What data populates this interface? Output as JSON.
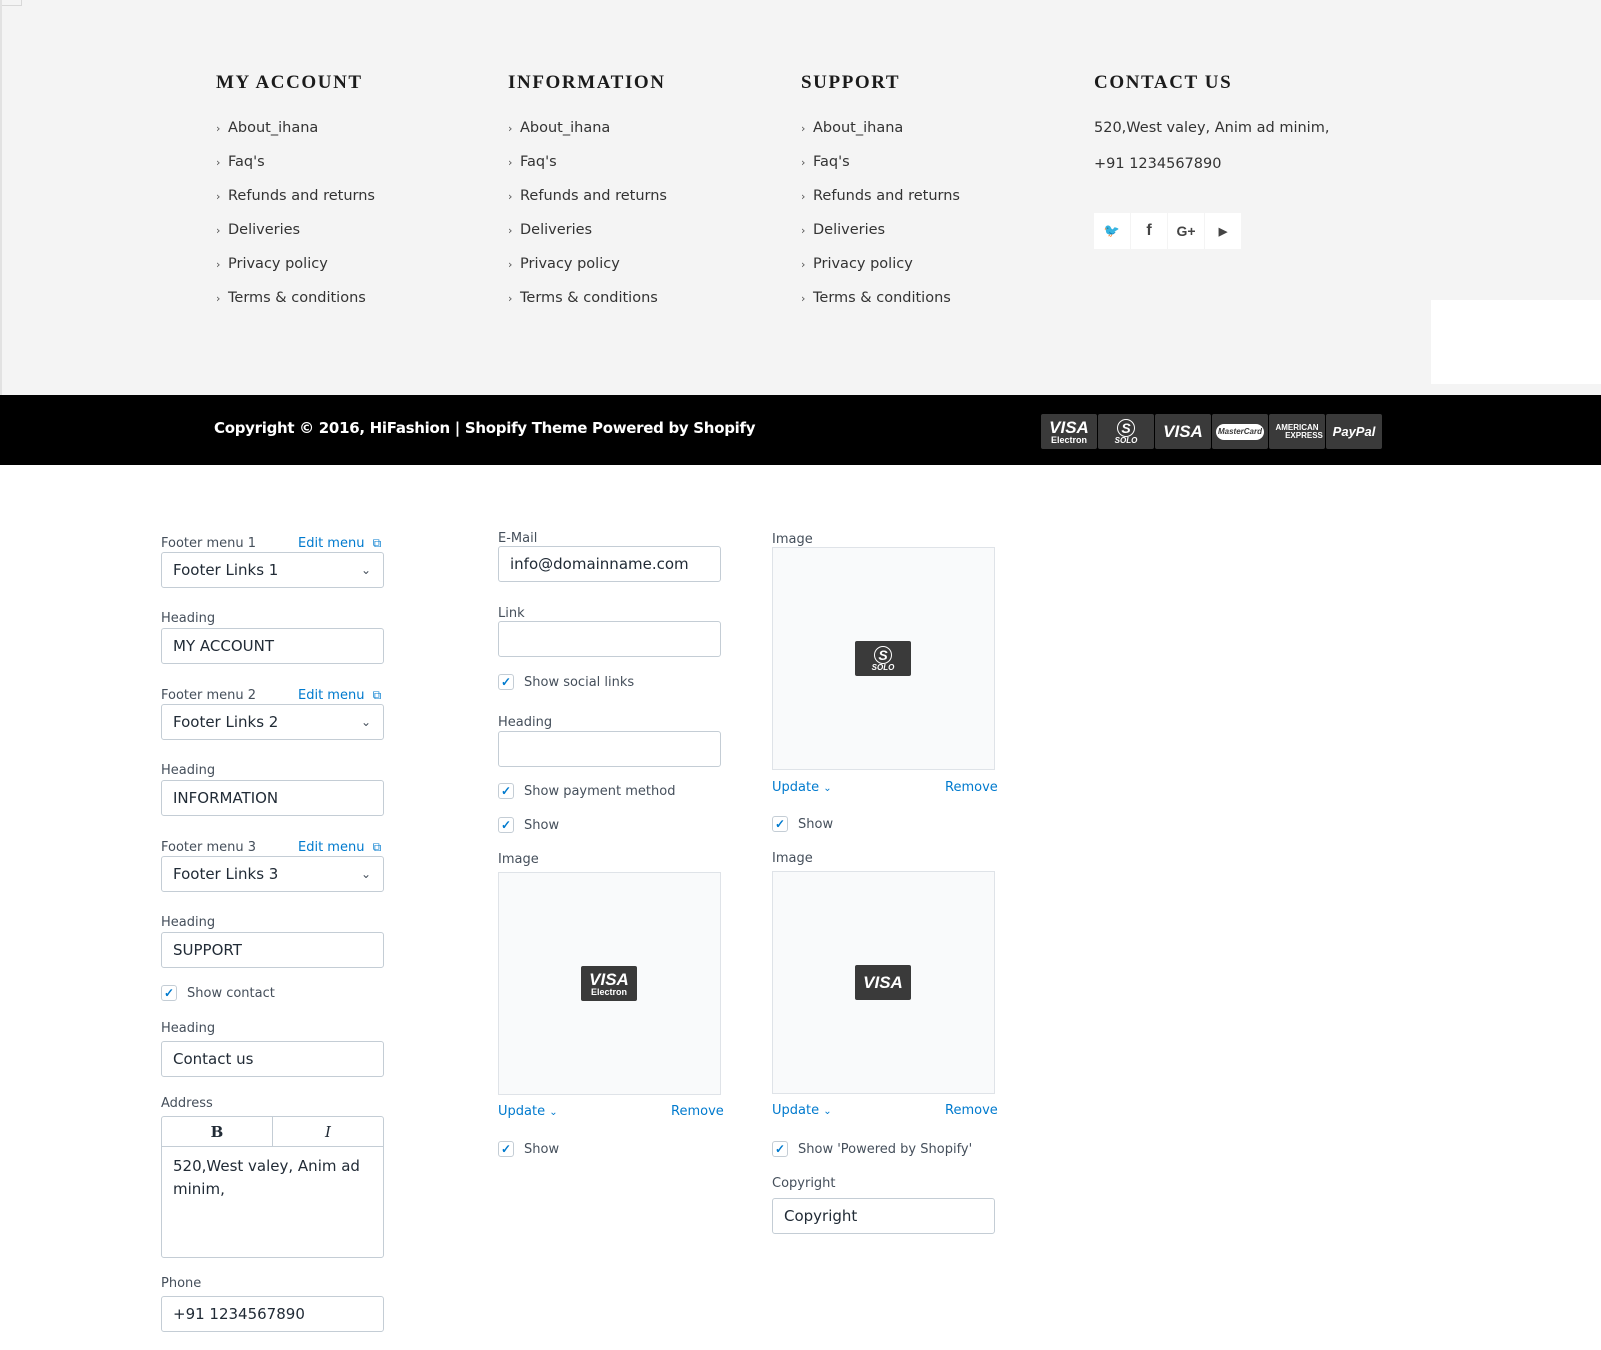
{
  "footer": {
    "columns": [
      {
        "heading": "MY ACCOUNT",
        "links": [
          "About_ihana",
          "Faq's",
          "Refunds and returns",
          "Deliveries",
          "Privacy policy",
          "Terms & conditions"
        ]
      },
      {
        "heading": "INFORMATION",
        "links": [
          "About_ihana",
          "Faq's",
          "Refunds and returns",
          "Deliveries",
          "Privacy policy",
          "Terms & conditions"
        ]
      },
      {
        "heading": "SUPPORT",
        "links": [
          "About_ihana",
          "Faq's",
          "Refunds and returns",
          "Deliveries",
          "Privacy policy",
          "Terms & conditions"
        ]
      }
    ],
    "contact": {
      "heading": "CONTACT US",
      "address": "520,West valey, Anim ad minim,",
      "phone": "+91 1234567890",
      "social_icons": [
        "twitter-icon",
        "facebook-icon",
        "google-plus-icon",
        "youtube-icon"
      ],
      "social_glyphs": [
        "🐦",
        "f",
        "G+",
        "▶"
      ]
    },
    "copyright": "Copyright © 2016, HiFashion | Shopify Theme Powered by Shopify",
    "payment_icons": [
      {
        "name": "visa-electron-icon",
        "line1": "VISA",
        "line2": "Electron"
      },
      {
        "name": "solo-icon",
        "line1": "S",
        "line2": "SOLO"
      },
      {
        "name": "visa-icon",
        "line1": "VISA",
        "line2": ""
      },
      {
        "name": "mastercard-icon",
        "line1": "MasterCard",
        "line2": ""
      },
      {
        "name": "american-express-icon",
        "line1": "AMERICAN",
        "line2": "EXPRESS"
      },
      {
        "name": "paypal-icon",
        "line1": "PayPal",
        "line2": ""
      }
    ]
  },
  "settings": {
    "menu1": {
      "label": "Footer menu 1",
      "edit": "Edit menu",
      "value": "Footer Links 1"
    },
    "heading1": {
      "label": "Heading",
      "value": "MY ACCOUNT"
    },
    "menu2": {
      "label": "Footer menu 2",
      "edit": "Edit menu",
      "value": "Footer Links 2"
    },
    "heading2": {
      "label": "Heading",
      "value": "INFORMATION"
    },
    "menu3": {
      "label": "Footer menu 3",
      "edit": "Edit menu",
      "value": "Footer Links 3"
    },
    "heading3": {
      "label": "Heading",
      "value": "SUPPORT"
    },
    "show_contact": {
      "label": "Show contact",
      "checked": true
    },
    "heading4": {
      "label": "Heading",
      "value": "Contact us"
    },
    "address": {
      "label": "Address",
      "bold": "B",
      "italic": "I",
      "value_line1": "520,West valey, Anim ad",
      "value_line2": "minim,"
    },
    "phone": {
      "label": "Phone",
      "value": "+91 1234567890"
    },
    "email": {
      "label": "E-Mail",
      "value": "info@domainname.com"
    },
    "link": {
      "label": "Link",
      "value": ""
    },
    "show_social": {
      "label": "Show social links",
      "checked": true
    },
    "heading5": {
      "label": "Heading",
      "value": ""
    },
    "show_payment": {
      "label": "Show payment method",
      "checked": true
    },
    "show_a": {
      "label": "Show",
      "checked": true
    },
    "image_a": {
      "label": "Image",
      "update": "Update",
      "remove": "Remove",
      "line1": "VISA",
      "line2": "Electron"
    },
    "show_b": {
      "label": "Show",
      "checked": true
    },
    "image_b": {
      "label": "Image",
      "update": "Update",
      "remove": "Remove",
      "line1": "S",
      "line2": "SOLO"
    },
    "show_c": {
      "label": "Show",
      "checked": true
    },
    "image_c": {
      "label": "Image",
      "update": "Update",
      "remove": "Remove",
      "line1": "VISA",
      "line2": ""
    },
    "show_powered": {
      "label": "Show 'Powered by Shopify'",
      "checked": true
    },
    "copyright": {
      "label": "Copyright",
      "value": "Copyright"
    }
  },
  "colors": {
    "link": "#007ace",
    "footer_bg": "#f4f4f4",
    "bar_bg": "#000000",
    "payment_icon": "#3a3a3a"
  }
}
